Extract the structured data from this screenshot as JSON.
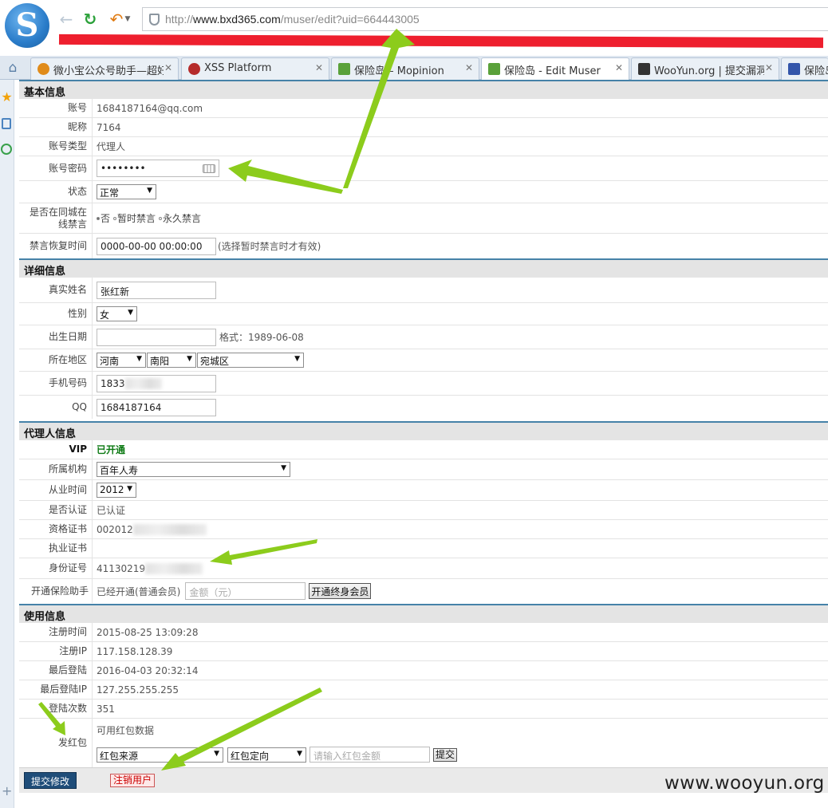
{
  "browser": {
    "url_prefix": "http://",
    "url_host": "www.bxd365.com",
    "url_path": "/muser/edit?uid=664443005",
    "tabs": [
      {
        "title": "微小宝公众号助手—超好",
        "color": "#e08b1a"
      },
      {
        "title": "XSS Platform",
        "color": "#b52b2b"
      },
      {
        "title": "保险岛 – Mopinion",
        "color": "#5aa13a"
      },
      {
        "title": "保险岛 - Edit Muser",
        "color": "#5aa13a"
      },
      {
        "title": "WooYun.org | 提交漏洞",
        "color": "#333333"
      },
      {
        "title": "保险岛",
        "color": "#3355aa"
      }
    ]
  },
  "sections": {
    "basic": "基本信息",
    "detail": "详细信息",
    "agent": "代理人信息",
    "usage": "使用信息"
  },
  "basic": {
    "account_label": "账号",
    "account_value": "1684187164@qq.com",
    "nickname_label": "昵称",
    "nickname_value": "7164",
    "type_label": "账号类型",
    "type_value": "代理人",
    "password_label": "账号密码",
    "password_value": "••••••••",
    "status_label": "状态",
    "status_value": "正常",
    "ban_label": "是否在同城在线禁言",
    "ban_options": [
      "否",
      "暂时禁言",
      "永久禁言"
    ],
    "restore_label": "禁言恢复时间",
    "restore_value": "0000-00-00 00:00:00",
    "restore_note": "(选择暂时禁言时才有效)"
  },
  "detail": {
    "realname_label": "真实姓名",
    "realname_value": "张红新",
    "gender_label": "性别",
    "gender_value": "女",
    "birth_label": "出生日期",
    "birth_value": "",
    "birth_note": "格式：1989-06-08",
    "region_label": "所在地区",
    "province": "河南",
    "city": "南阳",
    "district": "宛城区",
    "phone_label": "手机号码",
    "phone_value": "1833",
    "qq_label": "QQ",
    "qq_value": "1684187164"
  },
  "agent": {
    "vip_label": "VIP",
    "vip_value": "已开通",
    "org_label": "所属机构",
    "org_value": "百年人寿",
    "since_label": "从业时间",
    "since_value": "2012",
    "certified_label": "是否认证",
    "certified_value": "已认证",
    "qualification_label": "资格证书",
    "qualification_value": "002012",
    "practice_label": "执业证书",
    "practice_value": "",
    "id_label": "身份证号",
    "id_value": "41130219",
    "assistant_label": "开通保险助手",
    "assistant_value": "已经开通(普通会员)",
    "amount_placeholder": "金额（元）",
    "lifetime_button": "开通终身会员"
  },
  "usage": {
    "reg_time_label": "注册时间",
    "reg_time_value": "2015-08-25 13:09:28",
    "reg_ip_label": "注册IP",
    "reg_ip_value": "117.158.128.39",
    "last_login_label": "最后登陆",
    "last_login_value": "2016-04-03 20:32:14",
    "last_ip_label": "最后登陆IP",
    "last_ip_value": "127.255.255.255",
    "login_count_label": "登陆次数",
    "login_count_value": "351",
    "redpack_label": "发红包",
    "redpack_available": "可用红包数据",
    "redpack_source": "红包来源",
    "redpack_target": "红包定向",
    "redpack_amount_placeholder": "请输入红包金额",
    "redpack_submit": "提交"
  },
  "footer": {
    "submit": "提交修改",
    "cancel_user": "注销用户"
  },
  "watermark": "www.wooyun.org",
  "colors": {
    "section_border": "#4682a8",
    "arrow": "#8ccc1c",
    "redaction": "#ee1f2e",
    "vip_green": "#0d7a14"
  }
}
